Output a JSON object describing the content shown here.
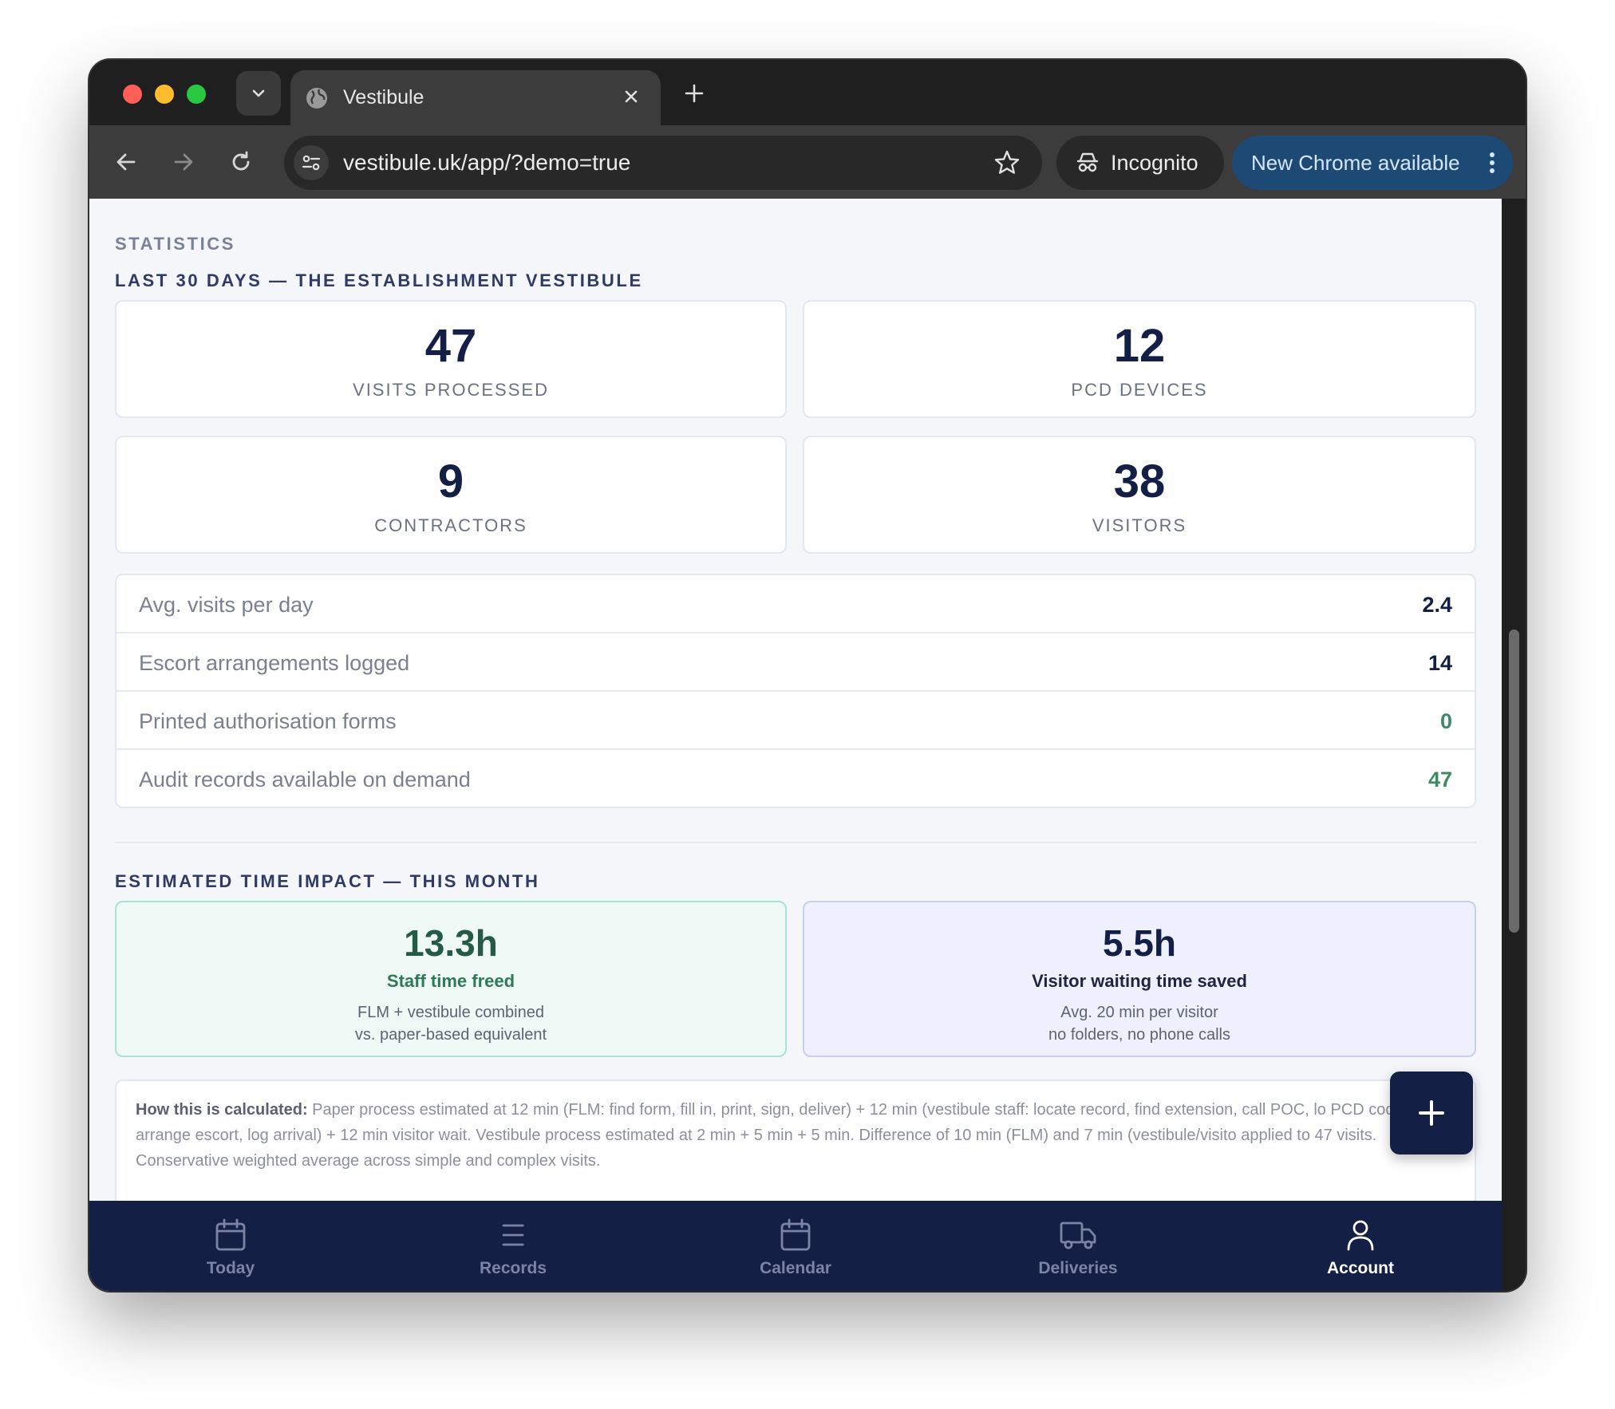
{
  "browser": {
    "tab_title": "Vestibule",
    "url": "vestibule.uk/app/?demo=true",
    "incognito_label": "Incognito",
    "update_label": "New Chrome available"
  },
  "statistics": {
    "section_label": "STATISTICS",
    "period_label": "LAST 30 DAYS — THE ESTABLISHMENT VESTIBULE",
    "cards": [
      {
        "value": "47",
        "label": "VISITS PROCESSED"
      },
      {
        "value": "12",
        "label": "PCD DEVICES"
      },
      {
        "value": "9",
        "label": "CONTRACTORS"
      },
      {
        "value": "38",
        "label": "VISITORS"
      }
    ],
    "rows": [
      {
        "label": "Avg. visits per day",
        "value": "2.4"
      },
      {
        "label": "Escort arrangements logged",
        "value": "14"
      },
      {
        "label": "Printed authorisation forms",
        "value": "0"
      },
      {
        "label": "Audit records available on demand",
        "value": "47"
      }
    ]
  },
  "impact": {
    "section_label": "ESTIMATED TIME IMPACT — THIS MONTH",
    "staff": {
      "value": "13.3h",
      "title": "Staff time freed",
      "line1": "FLM + vestibule combined",
      "line2": "vs. paper-based equivalent"
    },
    "visitor": {
      "value": "5.5h",
      "title": "Visitor waiting time saved",
      "line1": "Avg. 20 min per visitor",
      "line2": "no folders, no phone calls"
    },
    "calc_label": "How this is calculated:",
    "calc_text": "Paper process estimated at 12 min (FLM: find form, fill in, print, sign, deliver) + 12 min (vestibule staff: locate record, find extension, call POC, lo PCD code, arrange escort, log arrival) + 12 min visitor wait. Vestibule process estimated at 2 min + 5 min + 5 min. Difference of 10 min (FLM) and 7 min (vestibule/visito applied to 47 visits. Conservative weighted average across simple and complex visits."
  },
  "colors": {
    "navy": "#141f46",
    "green": "#3e8a65",
    "staff_bg": "#effaf6",
    "visitor_bg": "#eef1fd"
  },
  "nav": {
    "items": [
      {
        "label": "Today",
        "icon": "calendar-icon"
      },
      {
        "label": "Records",
        "icon": "list-icon"
      },
      {
        "label": "Calendar",
        "icon": "calendar-icon"
      },
      {
        "label": "Deliveries",
        "icon": "truck-icon"
      },
      {
        "label": "Account",
        "icon": "user-icon"
      }
    ],
    "active": "Account"
  }
}
